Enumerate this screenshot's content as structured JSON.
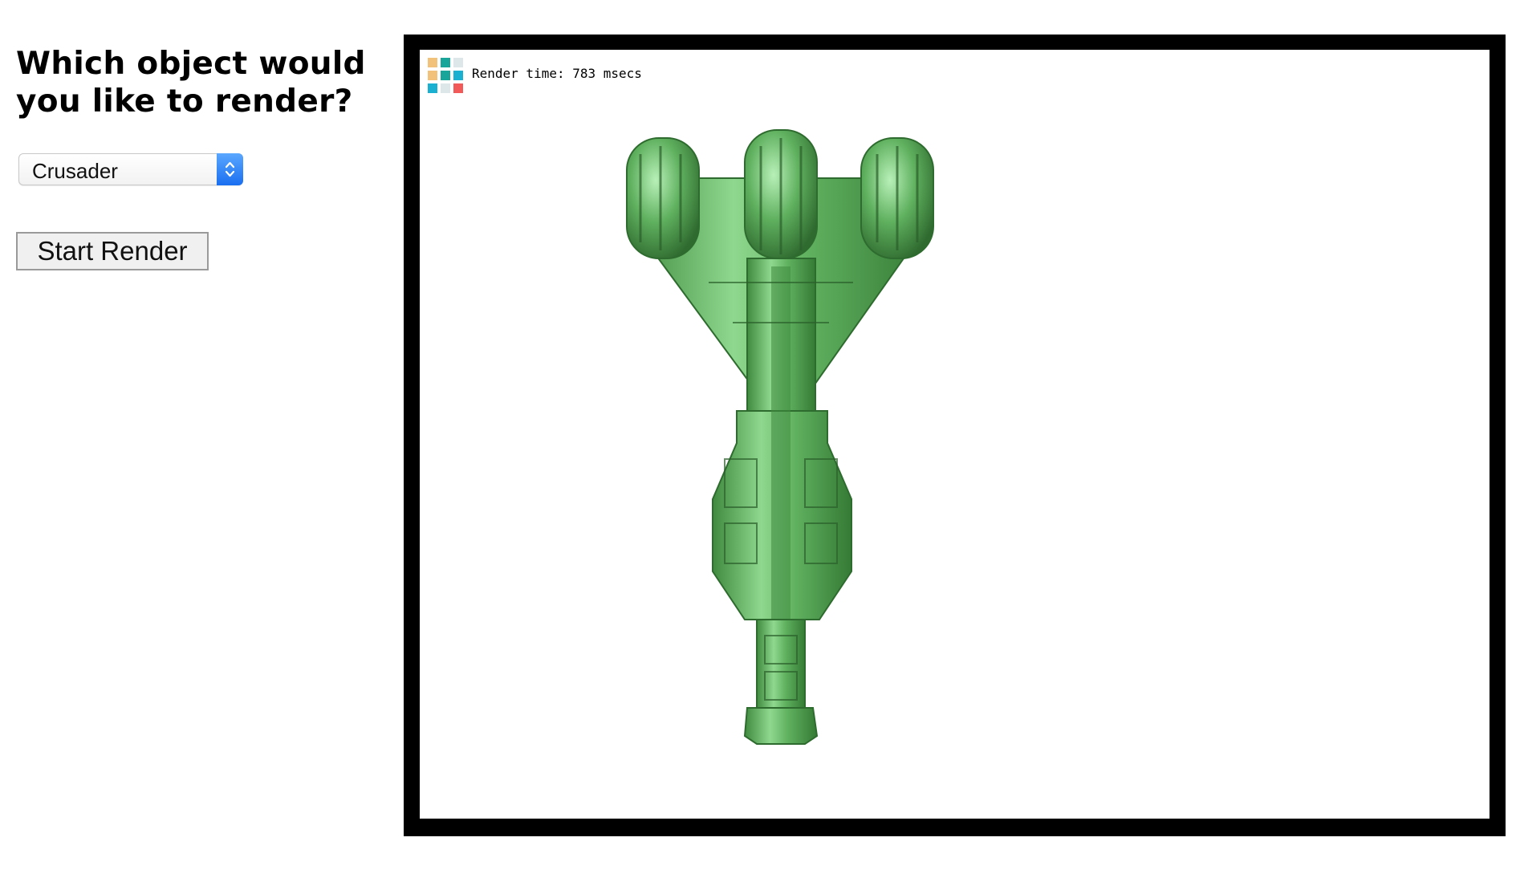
{
  "page": {
    "title": "Which object would you like to render?"
  },
  "controls": {
    "object_select": {
      "selected": "Crusader"
    },
    "start_button_label": "Start Render"
  },
  "viewport": {
    "render_time_label": "Render time: 783 msecs",
    "model_color": "#5fb05f",
    "frame_color": "#000000"
  },
  "icons": {
    "stats": "stats-grid-icon",
    "select_arrows": "chevron-up-down-icon"
  }
}
